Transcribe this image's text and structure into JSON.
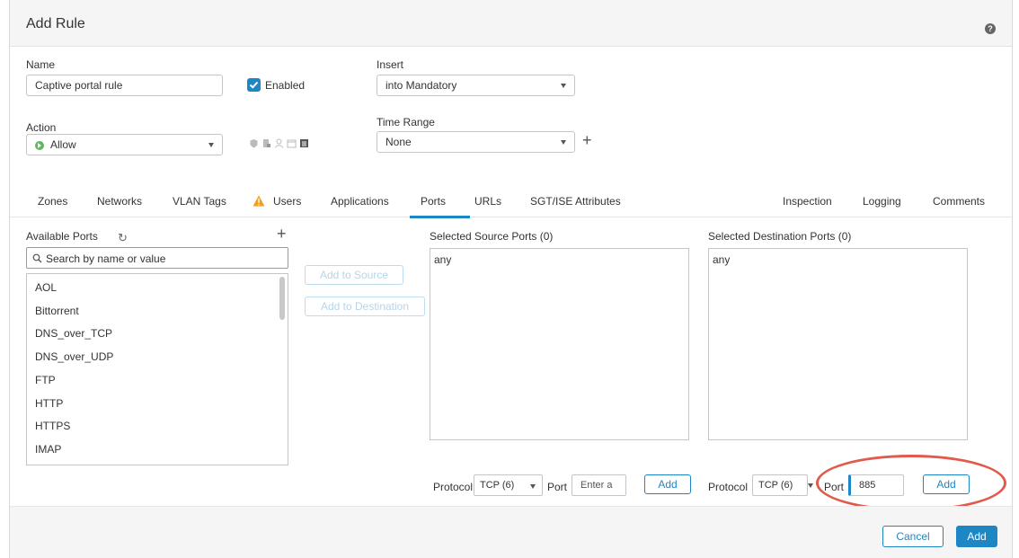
{
  "dialog": {
    "title": "Add Rule"
  },
  "form": {
    "name_label": "Name",
    "name_value": "Captive portal rule",
    "enabled_label": "Enabled",
    "enabled_checked": true,
    "insert_label": "Insert",
    "insert_value": "into Mandatory",
    "action_label": "Action",
    "action_value": "Allow",
    "time_range_label": "Time Range",
    "time_range_value": "None"
  },
  "tabs": {
    "left": [
      "Zones",
      "Networks",
      "VLAN Tags",
      "Users",
      "Applications",
      "Ports",
      "URLs",
      "SGT/ISE Attributes"
    ],
    "right": [
      "Inspection",
      "Logging",
      "Comments"
    ],
    "active": "Ports",
    "warning_tab": "Users"
  },
  "ports": {
    "available_label": "Available Ports",
    "search_placeholder": "Search by name or value",
    "available_items": [
      "AOL",
      "Bittorrent",
      "DNS_over_TCP",
      "DNS_over_UDP",
      "FTP",
      "HTTP",
      "HTTPS",
      "IMAP"
    ],
    "add_to_source": "Add to Source",
    "add_to_destination": "Add to Destination",
    "selected_source_label": "Selected Source Ports (0)",
    "selected_destination_label": "Selected Destination Ports (0)",
    "source_value": "any",
    "destination_value": "any",
    "source_protocol_label": "Protocol",
    "source_protocol_value": "TCP (6)",
    "source_port_label": "Port",
    "source_port_placeholder": "Enter a",
    "source_add_label": "Add",
    "dest_protocol_label": "Protocol",
    "dest_protocol_value": "TCP (6)",
    "dest_port_label": "Port",
    "dest_port_value": "885",
    "dest_add_label": "Add"
  },
  "footer": {
    "cancel_label": "Cancel",
    "add_label": "Add"
  },
  "colors": {
    "accent": "#1d87c6",
    "highlight": "#e05b4c",
    "allow": "#5cb85c",
    "warning": "#f0a020"
  },
  "icons": [
    "help-icon",
    "checkbox-check-icon",
    "allow-icon",
    "caret-down-icon",
    "plus-icon",
    "warning-icon",
    "refresh-icon",
    "search-icon"
  ]
}
